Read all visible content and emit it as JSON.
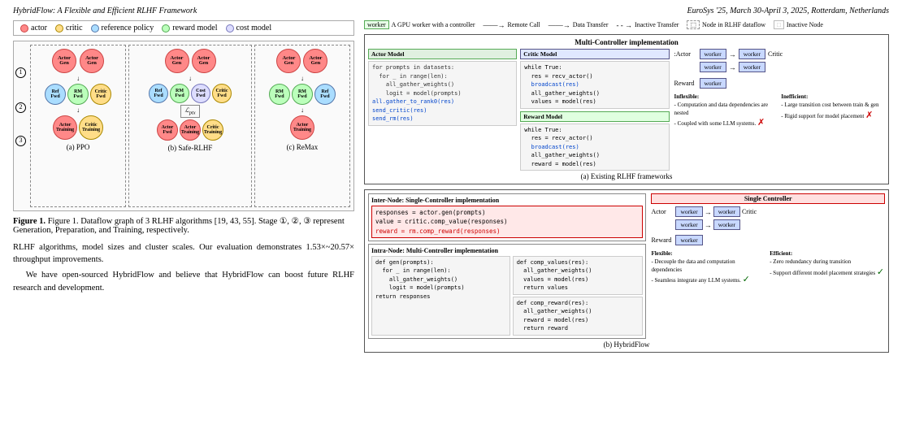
{
  "header": {
    "left": "HybridFlow: A Flexible and Efficient RLHF Framework",
    "right": "EuroSys '25, March 30-April 3, 2025, Rotterdam, Netherlands"
  },
  "legend": {
    "items": [
      {
        "label": "actor",
        "class": "dot-actor"
      },
      {
        "label": "critic",
        "class": "dot-critic"
      },
      {
        "label": "reference policy",
        "class": "dot-ref"
      },
      {
        "label": "reward model",
        "class": "dot-reward"
      },
      {
        "label": "cost model",
        "class": "dot-cost"
      }
    ]
  },
  "figure_caption": "Figure 1. Dataflow graph of 3 RLHF algorithms [19, 43, 55]. Stage ①, ②, ③ represent Generation, Preparation, and Training, respectively.",
  "body_text": [
    "RLHF algorithms, model sizes and cluster scales. Our evaluation demonstrates 1.53×~20.57× throughput improvements.",
    "We have open-sourced HybridFlow and believe that HybridFlow can boost future RLHF research and development."
  ],
  "right_legend": {
    "items": [
      {
        "label": "worker  A GPU worker with a controller",
        "type": "worker"
      },
      {
        "label": "Remote Call",
        "type": "arrow"
      },
      {
        "label": "Data Transfer",
        "type": "arrow"
      },
      {
        "label": "Inactive Transfer",
        "type": "dashed-arrow"
      },
      {
        "label": "Node in RLHF dataflow",
        "type": "dashed-box"
      },
      {
        "label": "Inactive Node",
        "type": "inactive"
      }
    ]
  },
  "panels": {
    "existing_title": "Multi-Controller implementation",
    "existing_sub_label": "(a) Existing RLHF frameworks",
    "hybrid_sub_label": "(b) HybridFlow",
    "critic_model_label": "Critic Model",
    "actor_model_label": "Actor Model",
    "reward_model_label": "Reward Model",
    "actor_code": "for prompts in datasets:\n  for _ in range(len):\n    all_gather_weights()\n    logit = model(prompts)\nall.gather_to_rank0(res)\nsend_critic(res)\nsend_rm(res)",
    "critic_code": "while True:\n  res = recv_actor()\n  broadcast(res)\n  all_gather_weights()\n  values = model(res)",
    "reward_code": "while True:\n  res = recv_actor()\n  broadcast(res)\n  all_gather_weights()\n  reward = model(res)",
    "inflexible_title": "Inflexible:",
    "inflexible_items": [
      "- Computation and data dependencies are nested",
      "- Coupled with some LLM systems."
    ],
    "inefficient_title": "Inefficient:",
    "inefficient_items": [
      "- Large transition cost between train & gen",
      "- Rigid support for model placement"
    ],
    "inter_node_title": "Inter-Node: Single-Controller implementation",
    "inter_node_code": "responses = actor.gen(prompts)\nvalue = critic.comp_value(responses)\nreward = rm.comp_reward(responses)",
    "intra_node_title": "Intra-Node: Multi-Controller implementation",
    "gen_code": "def gen(prompts):\n  for _ in range(len):\n    all_gather_weights()\n    logit = model(prompts)\n  return responses",
    "comp_reward_code": "def comp_reward(res):\n  all_gather_weights()\n  reward = model(res)\n  return reward",
    "comp_values_code": "def comp_values(res):\n  all_gather_weights()\n  values = model(res)\n  return values",
    "flexible_title": "Flexible:",
    "flexible_items": [
      "- Decouple the data and computation dependencies",
      "- Seamless integrate any LLM systems."
    ],
    "efficient_title": "Efficient:",
    "efficient_items": [
      "- Zero redundancy during transition",
      "- Support different model placement strategies"
    ],
    "single_controller_label": "Single Controller"
  },
  "algos": {
    "ppo_label": "(a) PPO",
    "safe_rlhf_label": "(b) Safe-RLHF",
    "remax_label": "(c) ReMax"
  }
}
